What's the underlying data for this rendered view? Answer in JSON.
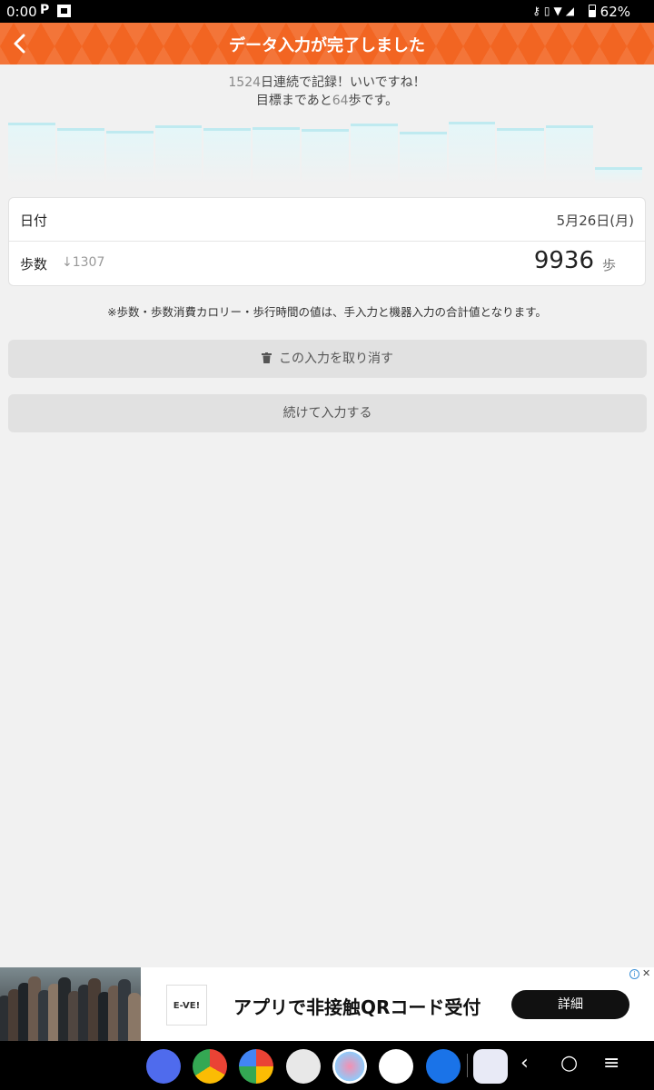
{
  "status_bar": {
    "time": "0:00",
    "notification": "P",
    "battery": "62%",
    "icons": [
      "key-icon",
      "vibrate-icon",
      "wifi-icon",
      "signal-icon",
      "battery-icon"
    ]
  },
  "header": {
    "title": "データ入力が完了しました",
    "background": "#f26522"
  },
  "messages": {
    "line1_pre": "",
    "line1_num": "1524",
    "line1_post": "日連続で記録！いいですね！",
    "line2_pre": "目標まであと",
    "line2_num": "64",
    "line2_post": "歩です。"
  },
  "chart_data": {
    "type": "bar",
    "values": [
      10800,
      9900,
      9400,
      10300,
      9900,
      10100,
      9700,
      10700,
      9300,
      11000,
      9900,
      10400,
      3000
    ],
    "ylim": [
      0,
      12000
    ],
    "grid": false,
    "color": "#bfeaf0"
  },
  "record": {
    "date_label": "日付",
    "date_value": "5月26日(月)",
    "steps_label": "歩数",
    "steps_delta": "↓1307",
    "steps_value": "9936",
    "steps_unit": "歩"
  },
  "note": "※歩数・歩数消費カロリー・歩行時間の値は、手入力と機器入力の合計値となります。",
  "buttons": {
    "cancel": "この入力を取り消す",
    "continue": "続けて入力する"
  },
  "ad": {
    "logo_text": "E-VE!",
    "text": "アプリで非接触QRコード受付",
    "button": "詳細",
    "info": "i",
    "close": "✕"
  },
  "navbar": {
    "apps": [
      "messages-icon",
      "chrome-icon",
      "photos-icon",
      "camera-icon",
      "gallery-icon",
      "maps-icon",
      "settings-icon",
      "apps-icon"
    ],
    "back": "‹",
    "home": "○",
    "recents": "≡"
  }
}
